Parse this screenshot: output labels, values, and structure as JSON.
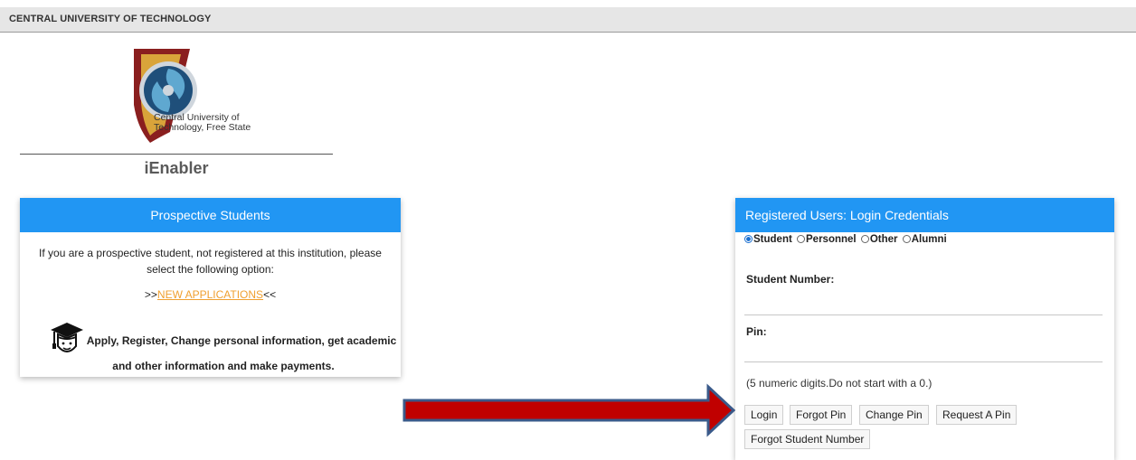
{
  "header": {
    "title": "CENTRAL UNIVERSITY OF TECHNOLOGY"
  },
  "logo": {
    "line1": "Central University of",
    "line2": "Technology, Free State",
    "icon": "cut-logo-icon"
  },
  "brand": {
    "name": "iEnabler"
  },
  "prospective": {
    "title": "Prospective Students",
    "intro": "If you are a prospective student, not registered at this institution, please select the following option:",
    "link_prefix": ">>",
    "link_text": "NEW APPLICATIONS",
    "link_suffix": "<<",
    "apply_line1": "Apply, Register, Change personal information, get academic",
    "apply_line2": "and other information and make payments.",
    "icon": "graduation-cap-icon"
  },
  "login": {
    "title": "Registered Users: Login Credentials",
    "user_types": [
      {
        "label": "Student",
        "selected": true
      },
      {
        "label": "Personnel",
        "selected": false
      },
      {
        "label": "Other",
        "selected": false
      },
      {
        "label": "Alumni",
        "selected": false
      }
    ],
    "student_number_label": "Student Number:",
    "student_number_value": "",
    "pin_label": "Pin:",
    "pin_value": "",
    "pin_hint": "(5 numeric digits.Do not start with a 0.)",
    "buttons": {
      "login": "Login",
      "forgot_pin": "Forgot Pin",
      "change_pin": "Change Pin",
      "request_pin": "Request A Pin",
      "forgot_student_number": "Forgot Student Number"
    }
  },
  "annotation": {
    "icon": "pointer-arrow-icon",
    "color": "#c00000",
    "outline": "#3a5a8a"
  },
  "colors": {
    "header_bg": "#2196f3",
    "link": "#f0a030",
    "topbar": "#e6e6e6"
  }
}
